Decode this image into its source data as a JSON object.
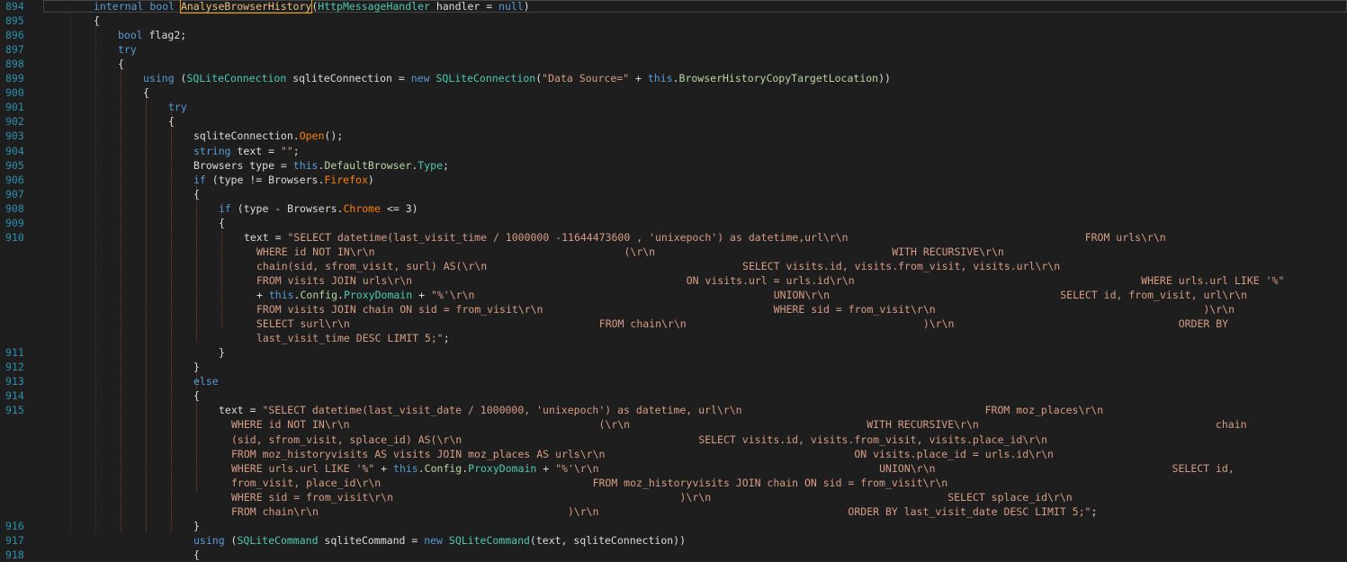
{
  "editor": {
    "lines": [
      {
        "ln": "894",
        "indent": 104,
        "tokens": [
          [
            "kw",
            "internal "
          ],
          [
            "kw",
            "bool "
          ],
          [
            "hl",
            "AnalyseBrowserHistory"
          ],
          [
            "p",
            "("
          ],
          [
            "ty",
            "HttpMessageHandler"
          ],
          [
            "p",
            " handler = "
          ],
          [
            "kw",
            "null"
          ],
          [
            "p",
            ")"
          ]
        ]
      },
      {
        "ln": "895",
        "indent": 104,
        "tokens": [
          [
            "p",
            "{"
          ]
        ]
      },
      {
        "ln": "896",
        "indent": 131,
        "tokens": [
          [
            "kw",
            "bool "
          ],
          [
            "p",
            "flag2;"
          ]
        ]
      },
      {
        "ln": "897",
        "indent": 131,
        "tokens": [
          [
            "kw",
            "try"
          ]
        ]
      },
      {
        "ln": "898",
        "indent": 131,
        "tokens": [
          [
            "p",
            "{"
          ]
        ]
      },
      {
        "ln": "899",
        "indent": 159,
        "tokens": [
          [
            "kw",
            "using "
          ],
          [
            "p",
            "("
          ],
          [
            "ty",
            "SQLiteConnection"
          ],
          [
            "p",
            " sqliteConnection = "
          ],
          [
            "kw",
            "new "
          ],
          [
            "ty",
            "SQLiteConnection"
          ],
          [
            "p",
            "("
          ],
          [
            "str",
            "\"Data Source=\""
          ],
          [
            "p",
            " + "
          ],
          [
            "kw",
            "this"
          ],
          [
            "p",
            "."
          ],
          [
            "mb",
            "BrowserHistoryCopyTargetLocation"
          ],
          [
            "p",
            "))"
          ]
        ]
      },
      {
        "ln": "900",
        "indent": 159,
        "tokens": [
          [
            "p",
            "{"
          ]
        ]
      },
      {
        "ln": "901",
        "indent": 187,
        "tokens": [
          [
            "kw",
            "try"
          ]
        ]
      },
      {
        "ln": "902",
        "indent": 187,
        "tokens": [
          [
            "p",
            "{"
          ]
        ]
      },
      {
        "ln": "903",
        "indent": 215,
        "tokens": [
          [
            "p",
            "sqliteConnection."
          ],
          [
            "ovl",
            "Open"
          ],
          [
            "p",
            "();"
          ]
        ]
      },
      {
        "ln": "904",
        "indent": 215,
        "tokens": [
          [
            "kw",
            "string "
          ],
          [
            "p",
            "text = "
          ],
          [
            "str",
            "\"\""
          ],
          [
            "p",
            ";"
          ]
        ]
      },
      {
        "ln": "905",
        "indent": 215,
        "tokens": [
          [
            "p",
            "Browsers type = "
          ],
          [
            "kw",
            "this"
          ],
          [
            "p",
            "."
          ],
          [
            "mb",
            "DefaultBrowser"
          ],
          [
            "p",
            "."
          ],
          [
            "prop",
            "Type"
          ],
          [
            "p",
            ";"
          ]
        ]
      },
      {
        "ln": "906",
        "indent": 215,
        "tokens": [
          [
            "kw",
            "if "
          ],
          [
            "p",
            "(type != Browsers."
          ],
          [
            "ovl",
            "Firefox"
          ],
          [
            "p",
            ")"
          ]
        ]
      },
      {
        "ln": "907",
        "indent": 215,
        "tokens": [
          [
            "p",
            "{"
          ]
        ]
      },
      {
        "ln": "908",
        "indent": 243,
        "tokens": [
          [
            "kw",
            "if "
          ],
          [
            "p",
            "(type - Browsers."
          ],
          [
            "ovl",
            "Chrome"
          ],
          [
            "p",
            " <= 3)"
          ]
        ]
      },
      {
        "ln": "909",
        "indent": 243,
        "tokens": [
          [
            "p",
            "{"
          ]
        ]
      },
      {
        "ln": "910",
        "indent": 271,
        "tokens": [
          [
            "p",
            "text = "
          ],
          [
            "str",
            "\"SELECT datetime(last_visit_time / 1000000 -11644473600 , 'unixepoch') as datetime,url\\r\\n                                      FROM urls\\r\\n"
          ]
        ]
      },
      {
        "ln": "",
        "indent": 285,
        "tokens": [
          [
            "str",
            "WHERE id NOT IN\\r\\n                                        (\\r\\n                                      WITH RECURSIVE\\r\\n"
          ]
        ]
      },
      {
        "ln": "",
        "indent": 285,
        "tokens": [
          [
            "str",
            "chain(sid, sfrom_visit, surl) AS(\\r\\n                                         SELECT visits.id, visits.from_visit, visits.url\\r\\n"
          ]
        ]
      },
      {
        "ln": "",
        "indent": 285,
        "tokens": [
          [
            "str",
            "FROM visits JOIN urls\\r\\n                                            ON visits.url = urls.id\\r\\n                                              WHERE urls.url LIKE '%\""
          ]
        ]
      },
      {
        "ln": "",
        "indent": 285,
        "tokens": [
          [
            "p",
            "+ "
          ],
          [
            "kw",
            "this"
          ],
          [
            "p",
            "."
          ],
          [
            "mb",
            "Config"
          ],
          [
            "p",
            "."
          ],
          [
            "prop",
            "ProxyDomain"
          ],
          [
            "p",
            " + "
          ],
          [
            "str",
            "\"%'\\r\\n                                                UNION\\r\\n                                     SELECT id, from_visit, url\\r\\n"
          ]
        ]
      },
      {
        "ln": "",
        "indent": 285,
        "tokens": [
          [
            "str",
            "FROM visits JOIN chain ON sid = from_visit\\r\\n                                     WHERE sid = from_visit\\r\\n                                           )\\r\\n"
          ]
        ]
      },
      {
        "ln": "",
        "indent": 285,
        "tokens": [
          [
            "str",
            "SELECT surl\\r\\n                                        FROM chain\\r\\n                                      )\\r\\n                                    ORDER BY"
          ]
        ]
      },
      {
        "ln": "",
        "indent": 285,
        "tokens": [
          [
            "str",
            "last_visit_time DESC LIMIT 5;\""
          ],
          [
            "p",
            ";"
          ]
        ]
      },
      {
        "ln": "911",
        "indent": 243,
        "tokens": [
          [
            "p",
            "}"
          ]
        ]
      },
      {
        "ln": "912",
        "indent": 215,
        "tokens": [
          [
            "p",
            "}"
          ]
        ]
      },
      {
        "ln": "913",
        "indent": 215,
        "tokens": [
          [
            "kw",
            "else"
          ]
        ]
      },
      {
        "ln": "914",
        "indent": 215,
        "tokens": [
          [
            "p",
            "{"
          ]
        ]
      },
      {
        "ln": "915",
        "indent": 243,
        "tokens": [
          [
            "p",
            "text = "
          ],
          [
            "str",
            "\"SELECT datetime(last_visit_date / 1000000, 'unixepoch') as datetime, url\\r\\n                                       FROM moz_places\\r\\n"
          ]
        ]
      },
      {
        "ln": "",
        "indent": 257,
        "tokens": [
          [
            "str",
            "WHERE id NOT IN\\r\\n                                        (\\r\\n                                      WITH RECURSIVE\\r\\n                                      chain"
          ]
        ]
      },
      {
        "ln": "",
        "indent": 257,
        "tokens": [
          [
            "str",
            "(sid, sfrom_visit, splace_id) AS(\\r\\n                                      SELECT visits.id, visits.from_visit, visits.place_id\\r\\n"
          ]
        ]
      },
      {
        "ln": "",
        "indent": 257,
        "tokens": [
          [
            "str",
            "FROM moz_historyvisits AS visits JOIN moz_places AS urls\\r\\n                                        ON visits.place_id = urls.id\\r\\n"
          ]
        ]
      },
      {
        "ln": "",
        "indent": 257,
        "tokens": [
          [
            "str",
            "WHERE urls.url LIKE '%\""
          ],
          [
            "p",
            " + "
          ],
          [
            "kw",
            "this"
          ],
          [
            "p",
            "."
          ],
          [
            "mb",
            "Config"
          ],
          [
            "p",
            "."
          ],
          [
            "prop",
            "ProxyDomain"
          ],
          [
            "p",
            " + "
          ],
          [
            "str",
            "\"%'\\r\\n                                             UNION\\r\\n                                      SELECT id,"
          ]
        ]
      },
      {
        "ln": "",
        "indent": 257,
        "tokens": [
          [
            "str",
            "from_visit, place_id\\r\\n                                  FROM moz_historyvisits JOIN chain ON sid = from_visit\\r\\n"
          ]
        ]
      },
      {
        "ln": "",
        "indent": 257,
        "tokens": [
          [
            "str",
            "WHERE sid = from_visit\\r\\n                                              )\\r\\n                                      SELECT splace_id\\r\\n"
          ]
        ]
      },
      {
        "ln": "",
        "indent": 257,
        "tokens": [
          [
            "str",
            "FROM chain\\r\\n                                        )\\r\\n                                        ORDER BY last_visit_date DESC LIMIT 5;\""
          ],
          [
            "p",
            ";"
          ]
        ]
      },
      {
        "ln": "916",
        "indent": 215,
        "tokens": [
          [
            "p",
            "}"
          ]
        ]
      },
      {
        "ln": "917",
        "indent": 215,
        "tokens": [
          [
            "kw",
            "using "
          ],
          [
            "p",
            "("
          ],
          [
            "ty",
            "SQLiteCommand"
          ],
          [
            "p",
            " sqliteCommand = "
          ],
          [
            "kw",
            "new "
          ],
          [
            "ty",
            "SQLiteCommand"
          ],
          [
            "p",
            "(text, sqliteConnection))"
          ]
        ]
      },
      {
        "ln": "918",
        "indent": 215,
        "tokens": [
          [
            "p",
            "{"
          ]
        ]
      }
    ]
  }
}
